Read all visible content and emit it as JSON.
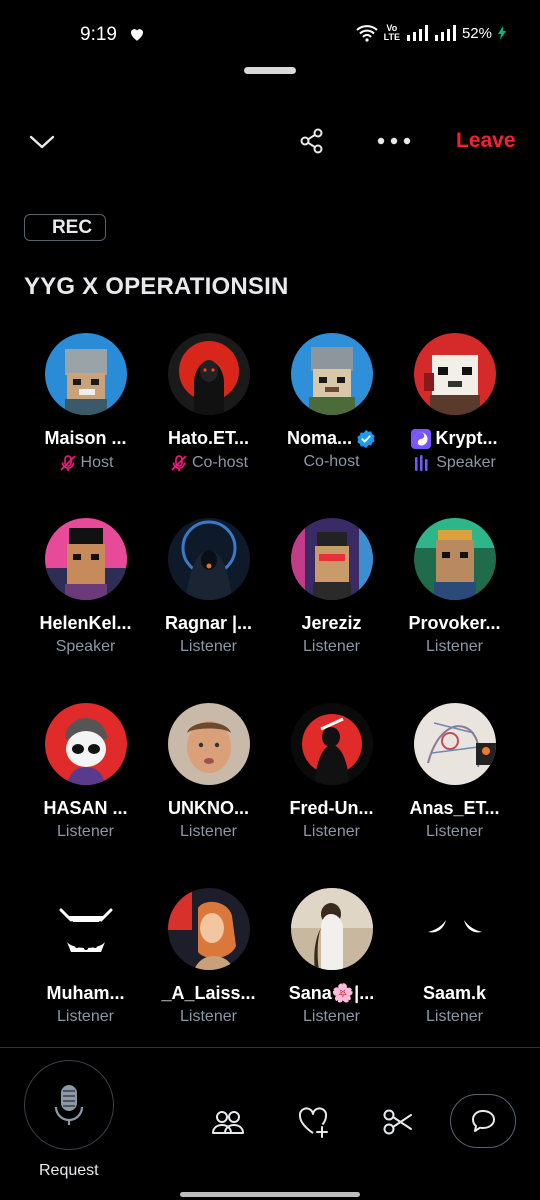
{
  "status": {
    "time": "9:19",
    "volte_top": "Vo",
    "volte_bottom": "LTE",
    "battery": "52%"
  },
  "header": {
    "leave_label": "Leave",
    "rec_label": "REC",
    "title": "YYG X OPERATIONSIN"
  },
  "participants": [
    {
      "name": "Maison ...",
      "role": "Host"
    },
    {
      "name": "Hato.ET...",
      "role": "Co-host"
    },
    {
      "name": "Noma...",
      "role": "Co-host"
    },
    {
      "name": "Krypt...",
      "role": "Speaker"
    },
    {
      "name": "HelenKel...",
      "role": "Speaker"
    },
    {
      "name": "Ragnar |...",
      "role": "Listener"
    },
    {
      "name": "Jereziz",
      "role": "Listener"
    },
    {
      "name": "Provoker...",
      "role": "Listener"
    },
    {
      "name": "HASAN ...",
      "role": "Listener"
    },
    {
      "name": "UNKNO...",
      "role": "Listener"
    },
    {
      "name": "Fred-Un...",
      "role": "Listener"
    },
    {
      "name": "Anas_ET...",
      "role": "Listener"
    },
    {
      "name": "Muham...",
      "role": "Listener"
    },
    {
      "name": "_A_Laiss...",
      "role": "Listener"
    },
    {
      "name": "Sana🌸|...",
      "role": "Listener"
    },
    {
      "name": "Saam.k",
      "role": "Listener"
    }
  ],
  "bottom": {
    "request_label": "Request"
  },
  "colors": {
    "leave": "#f4212e",
    "verified": "#1d9bf0",
    "muted": "#f91880",
    "speaker": "#7856ff"
  }
}
